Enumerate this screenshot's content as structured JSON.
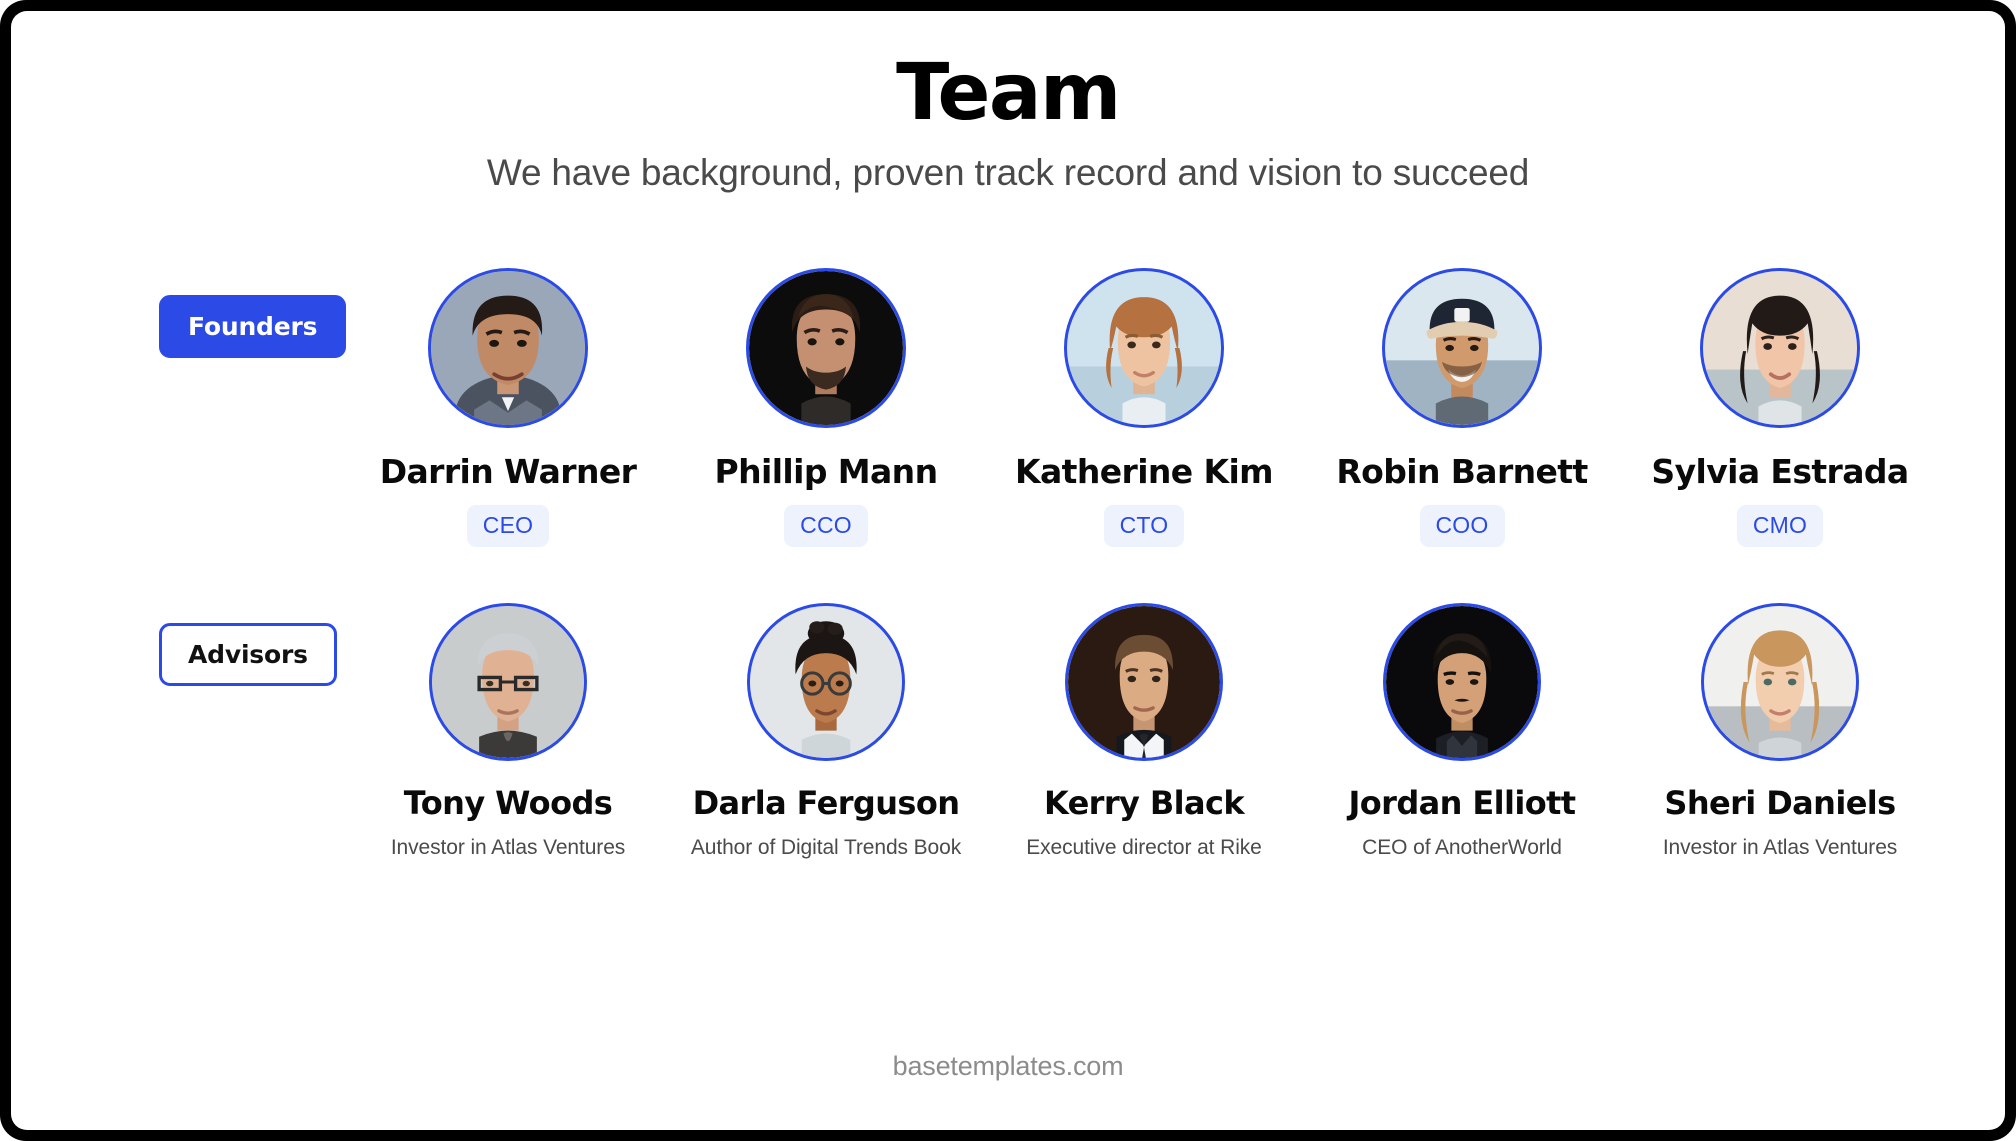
{
  "slide": {
    "title": "Team",
    "subtitle": "We have background, proven track record and vision to succeed",
    "footer": "basetemplates.com",
    "accent_color": "#2b4ae6",
    "badge_bg_color": "#eef2fc",
    "frame_color": "#000000",
    "background_color": "#ffffff"
  },
  "groups": [
    {
      "label": "Founders",
      "style": "filled",
      "members": [
        {
          "name": "Darrin Warner",
          "role": "CEO",
          "avatar": "avatar-darrin-warner"
        },
        {
          "name": "Phillip Mann",
          "role": "CCO",
          "avatar": "avatar-phillip-mann"
        },
        {
          "name": "Katherine Kim",
          "role": "CTO",
          "avatar": "avatar-katherine-kim"
        },
        {
          "name": "Robin Barnett",
          "role": "COO",
          "avatar": "avatar-robin-barnett"
        },
        {
          "name": "Sylvia Estrada",
          "role": "CMO",
          "avatar": "avatar-sylvia-estrada"
        }
      ]
    },
    {
      "label": "Advisors",
      "style": "outlined",
      "members": [
        {
          "name": "Tony Woods",
          "subtitle": "Investor in Atlas Ventures",
          "avatar": "avatar-tony-woods"
        },
        {
          "name": "Darla Ferguson",
          "subtitle": "Author of Digital Trends Book",
          "avatar": "avatar-darla-ferguson"
        },
        {
          "name": "Kerry Black",
          "subtitle": "Executive director at Rike",
          "avatar": "avatar-kerry-black"
        },
        {
          "name": "Jordan Elliott",
          "subtitle": "CEO of AnotherWorld",
          "avatar": "avatar-jordan-elliott"
        },
        {
          "name": "Sheri Daniels",
          "subtitle": "Investor in Atlas Ventures",
          "avatar": "avatar-sheri-daniels"
        }
      ]
    }
  ]
}
